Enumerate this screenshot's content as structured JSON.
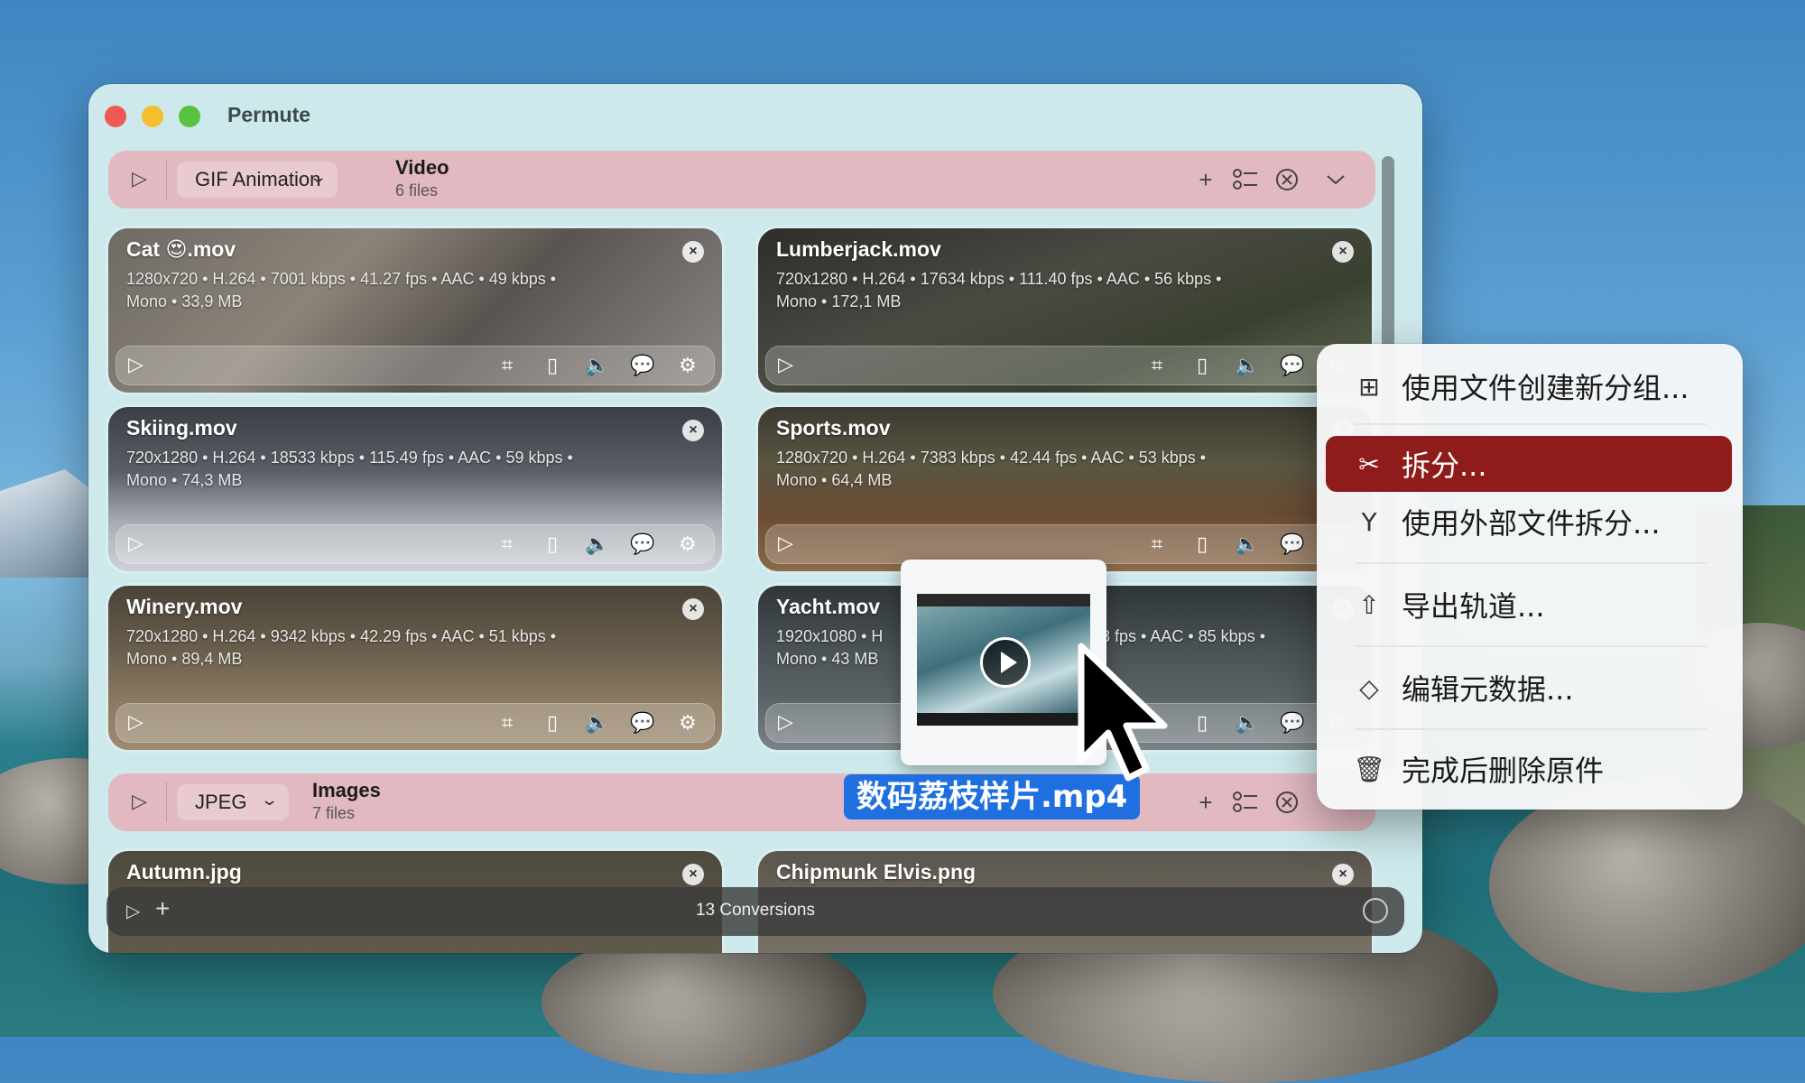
{
  "window": {
    "title": "Permute"
  },
  "video_group": {
    "preset": "GIF Animation",
    "name": "Video",
    "count": "6 files"
  },
  "image_group": {
    "preset": "JPEG",
    "name": "Images",
    "count": "7 files"
  },
  "cards": [
    {
      "name": "Cat 😍.mov",
      "meta1": "1280x720 • H.264 • 7001 kbps • 41.27 fps • AAC • 49 kbps •",
      "meta2": "Mono • 33,9 MB"
    },
    {
      "name": "Lumberjack.mov",
      "meta1": "720x1280 • H.264 • 17634 kbps • 111.40 fps • AAC • 56 kbps •",
      "meta2": "Mono • 172,1 MB"
    },
    {
      "name": "Skiing.mov",
      "meta1": "720x1280 • H.264 • 18533 kbps • 115.49 fps • AAC • 59 kbps •",
      "meta2": "Mono • 74,3 MB"
    },
    {
      "name": "Sports.mov",
      "meta1": "1280x720 • H.264 • 7383 kbps • 42.44 fps • AAC • 53 kbps •",
      "meta2": "Mono • 64,4 MB"
    },
    {
      "name": "Winery.mov",
      "meta1": "720x1280 • H.264 • 9342 kbps • 42.29 fps • AAC • 51 kbps •",
      "meta2": "Mono • 89,4 MB"
    },
    {
      "name": "Yacht.mov",
      "meta1": "1920x1080 • H",
      "meta1b": "8 fps • AAC • 85 kbps •",
      "meta2": "Mono • 43 MB"
    },
    {
      "name": "Autumn.jpg"
    },
    {
      "name": "Chipmunk Elvis.png"
    }
  ],
  "bottom_bar": {
    "text": "13 Conversions"
  },
  "drag": {
    "filename": "数码荔枝样片.mp4"
  },
  "context_menu": [
    {
      "icon": "grid-icon",
      "glyph": "⊞",
      "label": "使用文件创建新分组..."
    },
    {
      "icon": "scissors-icon",
      "glyph": "✂",
      "label": "拆分...",
      "active": true
    },
    {
      "icon": "split-icon",
      "glyph": "Y",
      "label": "使用外部文件拆分..."
    },
    {
      "icon": "share-icon",
      "glyph": "⇧",
      "label": "导出轨道..."
    },
    {
      "icon": "tag-icon",
      "glyph": "◇",
      "label": "编辑元数据..."
    },
    {
      "icon": "trash-icon",
      "glyph": "🗑",
      "label": "完成后删除原件"
    }
  ],
  "colors": {
    "group_bar": "#e2b9c1",
    "window": "#cde9ec",
    "menu_active": "#8f1b1b",
    "drag_label": "#1f6fe0"
  }
}
